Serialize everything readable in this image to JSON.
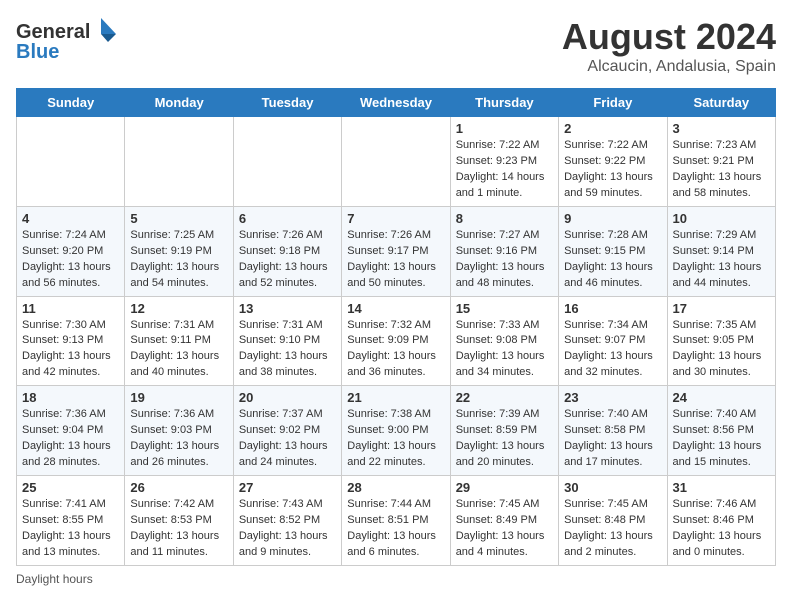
{
  "logo": {
    "line1": "General",
    "line2": "Blue"
  },
  "title": "August 2024",
  "subtitle": "Alcaucin, Andalusia, Spain",
  "days_of_week": [
    "Sunday",
    "Monday",
    "Tuesday",
    "Wednesday",
    "Thursday",
    "Friday",
    "Saturday"
  ],
  "weeks": [
    [
      {
        "day": "",
        "content": ""
      },
      {
        "day": "",
        "content": ""
      },
      {
        "day": "",
        "content": ""
      },
      {
        "day": "",
        "content": ""
      },
      {
        "day": "1",
        "content": "Sunrise: 7:22 AM\nSunset: 9:23 PM\nDaylight: 14 hours\nand 1 minute."
      },
      {
        "day": "2",
        "content": "Sunrise: 7:22 AM\nSunset: 9:22 PM\nDaylight: 13 hours\nand 59 minutes."
      },
      {
        "day": "3",
        "content": "Sunrise: 7:23 AM\nSunset: 9:21 PM\nDaylight: 13 hours\nand 58 minutes."
      }
    ],
    [
      {
        "day": "4",
        "content": "Sunrise: 7:24 AM\nSunset: 9:20 PM\nDaylight: 13 hours\nand 56 minutes."
      },
      {
        "day": "5",
        "content": "Sunrise: 7:25 AM\nSunset: 9:19 PM\nDaylight: 13 hours\nand 54 minutes."
      },
      {
        "day": "6",
        "content": "Sunrise: 7:26 AM\nSunset: 9:18 PM\nDaylight: 13 hours\nand 52 minutes."
      },
      {
        "day": "7",
        "content": "Sunrise: 7:26 AM\nSunset: 9:17 PM\nDaylight: 13 hours\nand 50 minutes."
      },
      {
        "day": "8",
        "content": "Sunrise: 7:27 AM\nSunset: 9:16 PM\nDaylight: 13 hours\nand 48 minutes."
      },
      {
        "day": "9",
        "content": "Sunrise: 7:28 AM\nSunset: 9:15 PM\nDaylight: 13 hours\nand 46 minutes."
      },
      {
        "day": "10",
        "content": "Sunrise: 7:29 AM\nSunset: 9:14 PM\nDaylight: 13 hours\nand 44 minutes."
      }
    ],
    [
      {
        "day": "11",
        "content": "Sunrise: 7:30 AM\nSunset: 9:13 PM\nDaylight: 13 hours\nand 42 minutes."
      },
      {
        "day": "12",
        "content": "Sunrise: 7:31 AM\nSunset: 9:11 PM\nDaylight: 13 hours\nand 40 minutes."
      },
      {
        "day": "13",
        "content": "Sunrise: 7:31 AM\nSunset: 9:10 PM\nDaylight: 13 hours\nand 38 minutes."
      },
      {
        "day": "14",
        "content": "Sunrise: 7:32 AM\nSunset: 9:09 PM\nDaylight: 13 hours\nand 36 minutes."
      },
      {
        "day": "15",
        "content": "Sunrise: 7:33 AM\nSunset: 9:08 PM\nDaylight: 13 hours\nand 34 minutes."
      },
      {
        "day": "16",
        "content": "Sunrise: 7:34 AM\nSunset: 9:07 PM\nDaylight: 13 hours\nand 32 minutes."
      },
      {
        "day": "17",
        "content": "Sunrise: 7:35 AM\nSunset: 9:05 PM\nDaylight: 13 hours\nand 30 minutes."
      }
    ],
    [
      {
        "day": "18",
        "content": "Sunrise: 7:36 AM\nSunset: 9:04 PM\nDaylight: 13 hours\nand 28 minutes."
      },
      {
        "day": "19",
        "content": "Sunrise: 7:36 AM\nSunset: 9:03 PM\nDaylight: 13 hours\nand 26 minutes."
      },
      {
        "day": "20",
        "content": "Sunrise: 7:37 AM\nSunset: 9:02 PM\nDaylight: 13 hours\nand 24 minutes."
      },
      {
        "day": "21",
        "content": "Sunrise: 7:38 AM\nSunset: 9:00 PM\nDaylight: 13 hours\nand 22 minutes."
      },
      {
        "day": "22",
        "content": "Sunrise: 7:39 AM\nSunset: 8:59 PM\nDaylight: 13 hours\nand 20 minutes."
      },
      {
        "day": "23",
        "content": "Sunrise: 7:40 AM\nSunset: 8:58 PM\nDaylight: 13 hours\nand 17 minutes."
      },
      {
        "day": "24",
        "content": "Sunrise: 7:40 AM\nSunset: 8:56 PM\nDaylight: 13 hours\nand 15 minutes."
      }
    ],
    [
      {
        "day": "25",
        "content": "Sunrise: 7:41 AM\nSunset: 8:55 PM\nDaylight: 13 hours\nand 13 minutes."
      },
      {
        "day": "26",
        "content": "Sunrise: 7:42 AM\nSunset: 8:53 PM\nDaylight: 13 hours\nand 11 minutes."
      },
      {
        "day": "27",
        "content": "Sunrise: 7:43 AM\nSunset: 8:52 PM\nDaylight: 13 hours\nand 9 minutes."
      },
      {
        "day": "28",
        "content": "Sunrise: 7:44 AM\nSunset: 8:51 PM\nDaylight: 13 hours\nand 6 minutes."
      },
      {
        "day": "29",
        "content": "Sunrise: 7:45 AM\nSunset: 8:49 PM\nDaylight: 13 hours\nand 4 minutes."
      },
      {
        "day": "30",
        "content": "Sunrise: 7:45 AM\nSunset: 8:48 PM\nDaylight: 13 hours\nand 2 minutes."
      },
      {
        "day": "31",
        "content": "Sunrise: 7:46 AM\nSunset: 8:46 PM\nDaylight: 13 hours\nand 0 minutes."
      }
    ]
  ],
  "footer": "Daylight hours"
}
